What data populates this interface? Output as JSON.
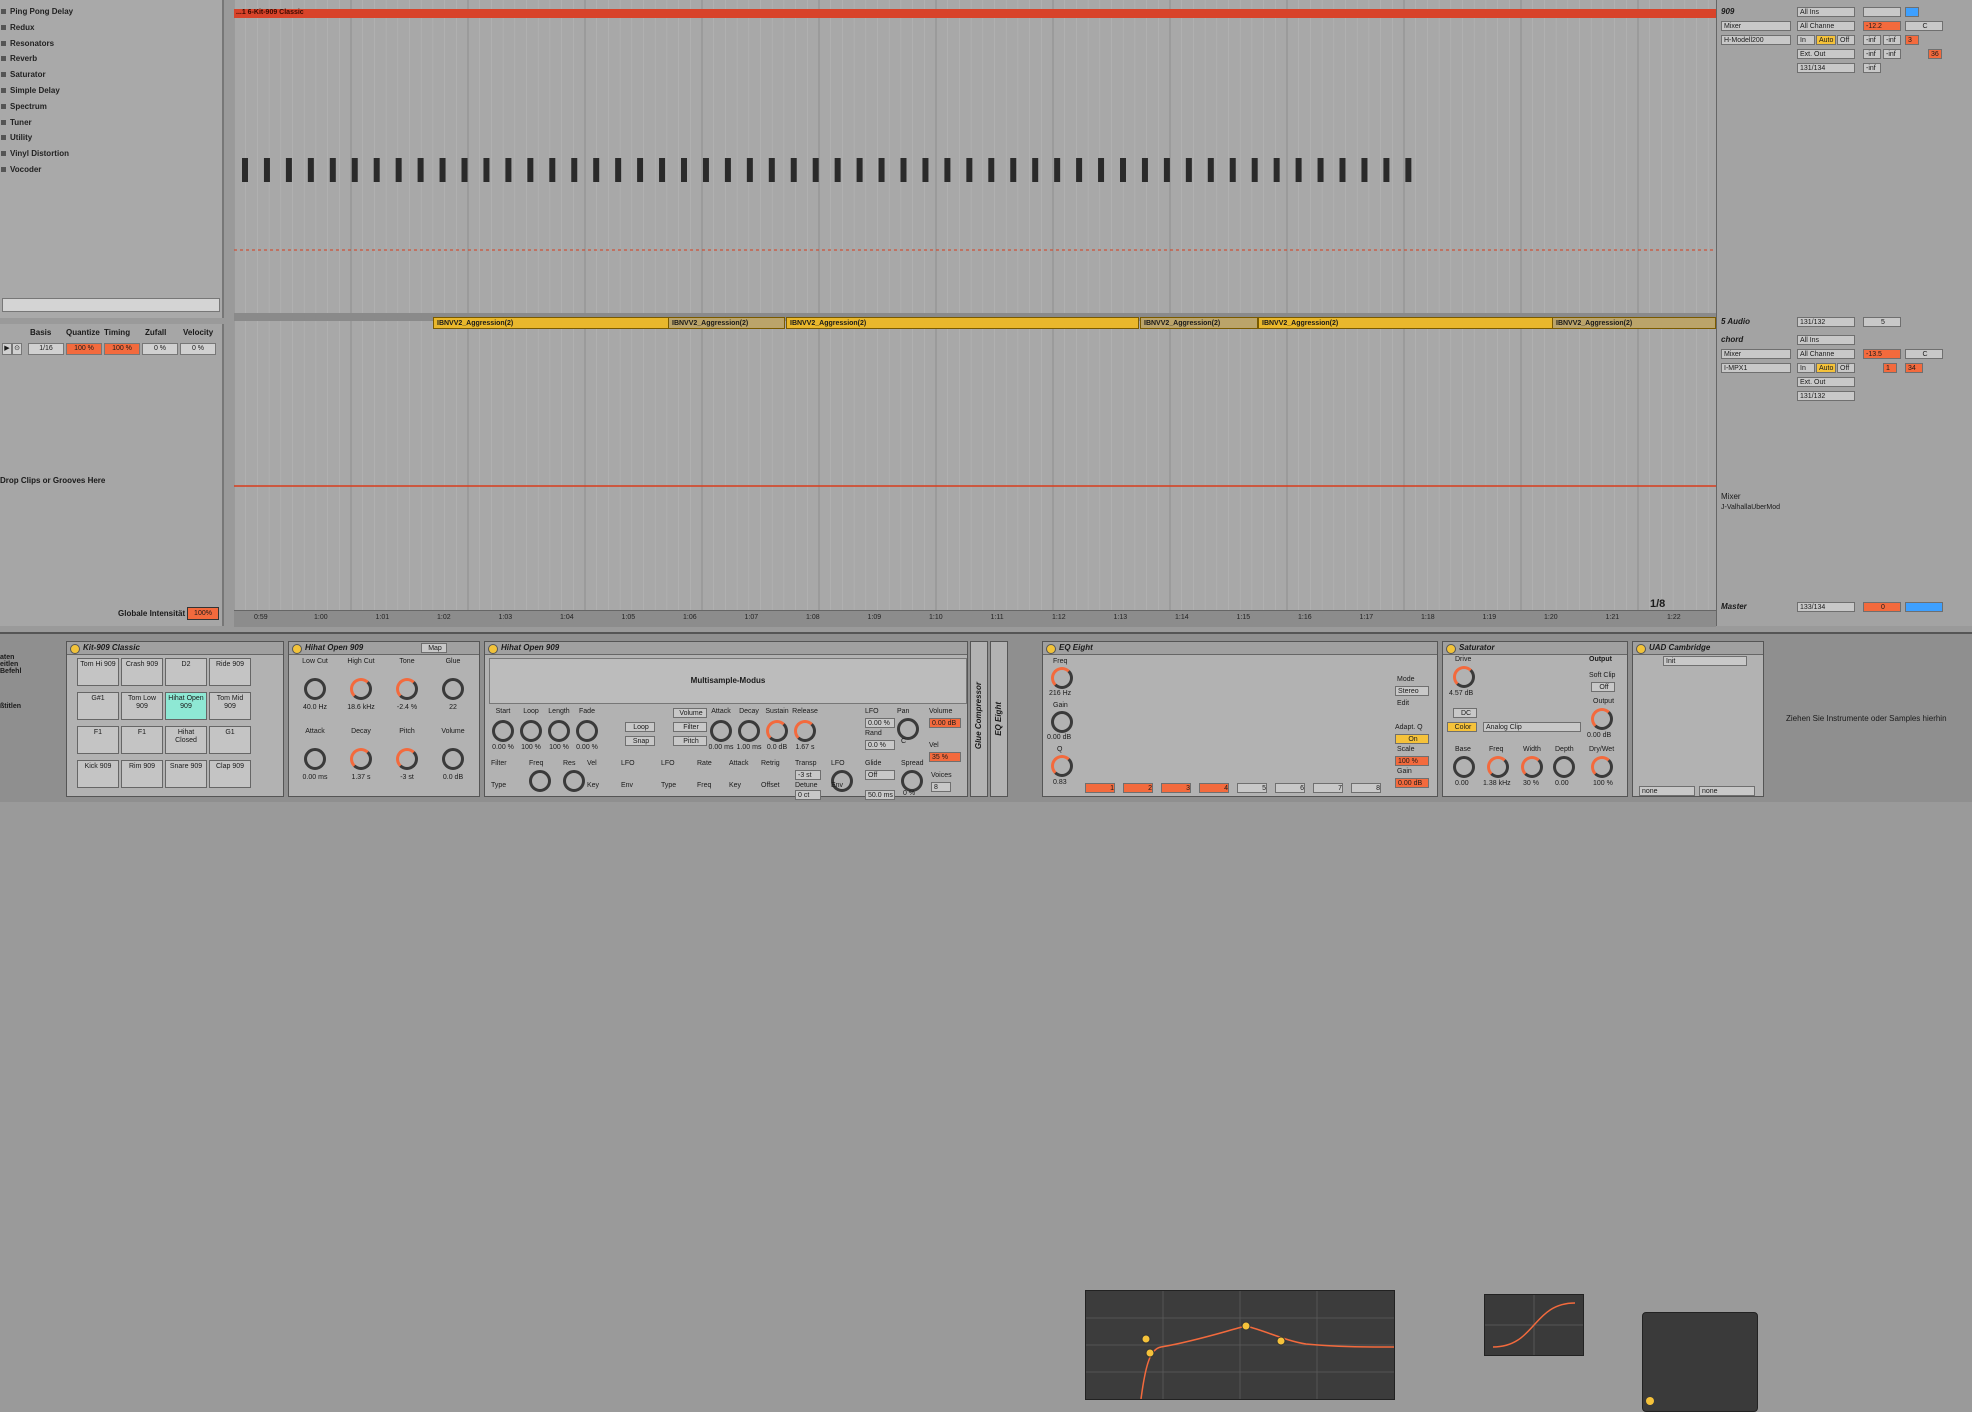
{
  "browser": {
    "items": [
      "Ping Pong Delay",
      "Redux",
      "Resonators",
      "Reverb",
      "Saturator",
      "Simple Delay",
      "Spectrum",
      "Tuner",
      "Utility",
      "Vinyl Distortion",
      "Vocoder"
    ]
  },
  "groove": {
    "headers": [
      "Basis",
      "Quantize",
      "Timing",
      "Zufall",
      "Velocity"
    ],
    "values": [
      "1/16",
      "100 %",
      "100 %",
      "0 %",
      "0 %"
    ],
    "drop_text": "Drop Clips or Grooves Here",
    "global_label": "Globale Intensität",
    "global_value": "100%"
  },
  "arrangement": {
    "top_clip": "...1 6-Kit-909 Classic",
    "audio_clips": [
      "IBNVV2_Aggression(2)",
      "IBNVV2_Aggression(2)",
      "IBNVV2_Aggression(2)",
      "IBNVV2_Aggression(2)",
      "IBNVV2_Aggression(2)",
      "IBNVV2_Aggression(2)"
    ],
    "ruler": [
      "1:00",
      "1:01",
      "1:02",
      "1:03",
      "1:04",
      "1:05",
      "1:06",
      "1:07",
      "1:08",
      "1:09",
      "1:10",
      "1:11",
      "1:12",
      "1:13",
      "1:14",
      "1:15",
      "1:16",
      "1:17",
      "1:18",
      "1:19",
      "1:20",
      "1:21",
      "1:22"
    ],
    "ruler_start": "0:59",
    "quantize": "1/8"
  },
  "mixer": {
    "track1": {
      "name": "909",
      "input": "All Ins",
      "channel": "All Channe",
      "monitor": [
        "In",
        "Auto",
        "Off"
      ],
      "output_device": "Mixer",
      "output_plugin": "H-Modell200",
      "ext_out": "Ext. Out",
      "range": "131/134",
      "vol": "-12.2",
      "pan": "C",
      "inf": "-inf",
      "n36": "36",
      "n3": "3"
    },
    "track2": {
      "name": "5 Audio",
      "range_top": "131/132",
      "num": "5"
    },
    "track3": {
      "name": "chord",
      "input": "All Ins",
      "channel": "All Channe",
      "monitor": [
        "In",
        "Auto",
        "Off"
      ],
      "device1": "Mixer",
      "device2": "I-MPX1",
      "ext_out": "Ext. Out",
      "range": "131/132",
      "vol": "-13.5",
      "pan": "C",
      "n1": "1",
      "n34": "34"
    },
    "mixer_label": "Mixer",
    "vst_label": "J-ValhallaUberMod",
    "master": {
      "name": "Master",
      "range": "133/134",
      "num": "0"
    }
  },
  "devices": {
    "kit": {
      "title": "Kit-909 Classic",
      "pads": [
        [
          "Tom Hi 909",
          "Crash 909",
          "D2",
          "Ride 909"
        ],
        [
          "G#1",
          "Tom Low 909",
          "Hihat Open 909",
          "Tom Mid 909"
        ],
        [
          "F1",
          "F1",
          "Hihat Closed",
          "G1"
        ],
        [
          "Kick 909",
          "Rim 909",
          "Snare 909",
          "Clap 909"
        ]
      ]
    },
    "hihat1": {
      "title": "Hihat Open 909",
      "map": "Map",
      "knobs": [
        [
          "Low Cut",
          "40.0 Hz"
        ],
        [
          "High Cut",
          "18.6 kHz"
        ],
        [
          "Tone",
          "-2.4 %"
        ],
        [
          "Glue",
          "22"
        ],
        [
          "Attack",
          "0.00 ms"
        ],
        [
          "Decay",
          "1.37 s"
        ],
        [
          "Pitch",
          "-3 st"
        ],
        [
          "Volume",
          "0.0 dB"
        ]
      ]
    },
    "hihat2": {
      "title": "Hihat Open 909",
      "mode": "Multisample-Modus",
      "labels": [
        "Start",
        "Loop",
        "Length",
        "Fade",
        "Attack",
        "Decay",
        "Sustain",
        "Release",
        "Pan",
        "Volume"
      ],
      "values": [
        "0.00 %",
        "100 %",
        "100 %",
        "0.00 %",
        "0.00 ms",
        "1.00 ms",
        "0.0 dB",
        "1.67 s",
        "C",
        "0.00 dB"
      ],
      "buttons": [
        "Loop",
        "Snap",
        "Volume",
        "Filter",
        "Pitch"
      ],
      "lfo": "LFO",
      "lfo_val": "0.00 %",
      "rand": "Rand",
      "rand_val": "0.0 %",
      "vel": "Vel",
      "vel_val": "35 %",
      "glide": "Glide",
      "glide_val": "Off",
      "spread": "Spread",
      "spread_val": "0 %",
      "voices": "Voices",
      "voices_val": "8",
      "time_val": "50.0 ms",
      "transp": "Transp",
      "transp_val": "-3 st",
      "detune": "Detune",
      "detune_val": "0 ct",
      "filter": "Filter",
      "type": "Type",
      "freq": "Freq",
      "res": "Res",
      "key": "Key",
      "env": "Env",
      "offset": "Offset",
      "retrig": "Retrig",
      "rate": "Rate"
    },
    "glue": {
      "title": "Glue Compressor"
    },
    "eq8": {
      "title": "EQ Eight",
      "verts": [
        "EQ Eight"
      ],
      "freq": "Freq",
      "freq_val": "216 Hz",
      "gain": "Gain",
      "gain_val": "0.00 dB",
      "q": "Q",
      "q_val": "0.83",
      "mode": "Mode",
      "mode_val": "Stereo",
      "edit": "Edit",
      "adapt": "Adapt. Q",
      "adapt_val": "On",
      "scale": "Scale",
      "scale_val": "100 %",
      "gain2": "Gain",
      "gain2_val": "0.00 dB",
      "bands": [
        "1",
        "2",
        "3",
        "4",
        "5",
        "6",
        "7",
        "8"
      ]
    },
    "saturator": {
      "title": "Saturator",
      "drive": "Drive",
      "drive_val": "4.57 dB",
      "output": "Output",
      "softclip": "Soft Clip",
      "softclip_val": "Off",
      "dc": "DC",
      "color": "Color",
      "type": "Analog Clip",
      "base": "Base",
      "base_val": "0.00",
      "freq": "Freq",
      "freq_val": "1.38 kHz",
      "width": "Width",
      "width_val": "30 %",
      "depth": "Depth",
      "depth_val": "0.00",
      "out_val": "0.00 dB",
      "drywet": "Dry/Wet",
      "drywet_val": "100 %"
    },
    "uad": {
      "title": "UAD Cambridge",
      "preset": "Init",
      "none1": "none",
      "none2": "none"
    },
    "hint": "Ziehen Sie Instrumente oder Samples hierhin",
    "left_items": [
      "aten",
      "eitlen",
      "Befehl",
      "ßtitlen"
    ]
  },
  "colors": {
    "orange": "#f36a3d",
    "yellow": "#f5c23a",
    "red_line": "#d83c1c",
    "pad_sel": "#8ee8d4",
    "blue": "#3ea0ff"
  }
}
